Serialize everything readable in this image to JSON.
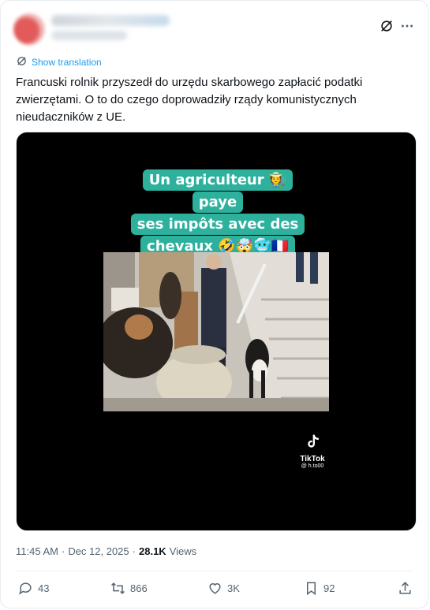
{
  "header": {
    "grok_icon": "grok-icon",
    "more_icon": "more-dots-icon"
  },
  "translate": {
    "label": "Show translation"
  },
  "tweet": {
    "text": "Francuski rolnik przyszedł do urzędu skarbowego zapłacić podatki\nzwierzętami. O to do czego doprowadziły rządy komunistycznych\nnieudaczników z UE."
  },
  "media": {
    "caption_lines": [
      "Un agriculteur 🧑‍🌾 paye",
      "ses impôts avec des",
      "chevaux 🤣🤯🥶🇫🇷"
    ],
    "tiktok_name": "TikTok",
    "tiktok_handle": "@ h.to00"
  },
  "meta": {
    "time": "11:45 AM",
    "separator": "·",
    "date": "Dec 12, 2025",
    "views_count": "28.1K",
    "views_label": "Views"
  },
  "actions": {
    "replies": "43",
    "reposts": "866",
    "likes": "3K",
    "bookmarks": "92"
  }
}
